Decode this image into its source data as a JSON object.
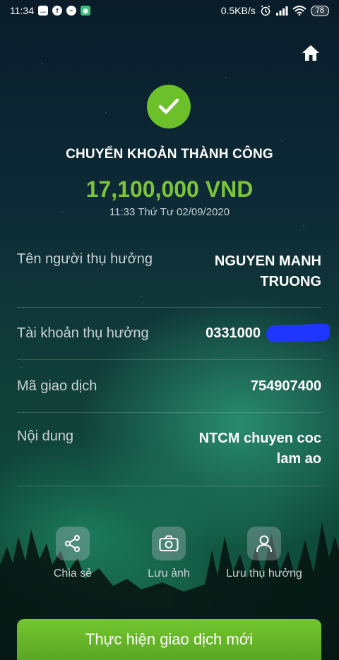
{
  "status_bar": {
    "time": "11:34",
    "network_speed": "0.5KB/s",
    "battery": "78",
    "icons": [
      "message-icon",
      "facebook-icon",
      "messenger-icon",
      "app-icon",
      "alarm-icon",
      "signal-icon",
      "wifi-icon",
      "battery-icon"
    ]
  },
  "header": {
    "home_icon": "home-icon"
  },
  "result": {
    "title": "CHUYỂN KHOẢN THÀNH CÔNG",
    "amount": "17,100,000 VND",
    "datetime": "11:33 Thứ Tư 02/09/2020",
    "accent_color": "#6cc02a"
  },
  "details": [
    {
      "label": "Tên người thụ hưởng",
      "value_line1": "NGUYEN MANH",
      "value_line2": "TRUONG"
    },
    {
      "label": "Tài khoản thụ hưởng",
      "value": "0331000"
    },
    {
      "label": "Mã giao dịch",
      "value": "754907400"
    },
    {
      "label": "Nội dung",
      "value_line1": "NTCM chuyen coc",
      "value_line2": "lam ao"
    }
  ],
  "actions": [
    {
      "label": "Chia sẻ",
      "icon": "share-icon"
    },
    {
      "label": "Lưu ảnh",
      "icon": "camera-icon"
    },
    {
      "label": "Lưu thụ hưởng",
      "icon": "person-icon"
    }
  ],
  "primary_button": {
    "label": "Thực hiện giao dịch mới",
    "color": "#6cc02a"
  }
}
